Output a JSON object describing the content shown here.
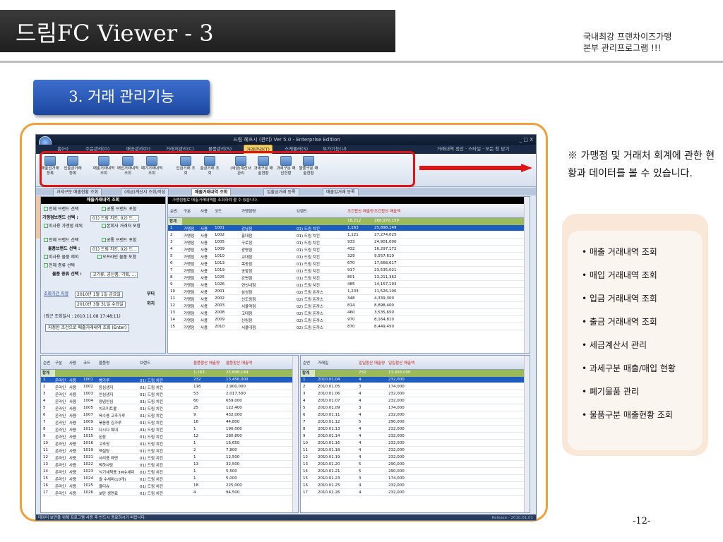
{
  "header": {
    "title": "드림FC Viewer - 3",
    "tagline_line1": "국내최강 프랜차이즈가맹",
    "tagline_line2": "본부 관리프로그램 !!!"
  },
  "section": {
    "label": "3. 거래 관리기능"
  },
  "app": {
    "title": "드림 헤프시 (관리) Ver 5.0 - Enterprise Edition",
    "window_controls": "_ □ X",
    "menu": [
      "홈(H)",
      "주문관리(O)",
      "배송관리(D)",
      "거래처관리(C)",
      "물품관리(S)",
      "거래관리(T)",
      "스케쥴러(S)",
      "부가기능(U)"
    ],
    "menu_active": "거래관리(T)",
    "menu_right": "거래내역 정산 · 스타일 · 모든 창 닫기",
    "ribbon": [
      "매출입거래 등록",
      "입출금거래 등록",
      "매출거래내역 조회",
      "매입거래내역 조회",
      "폐기거래내역 조회",
      "입금거래 조회",
      "출금거래 조회",
      "(세금)계산서 관리",
      "과세구분 매출현황",
      "과세구분 매입현황",
      "물품구분 매출현황"
    ],
    "tabs": [
      "과세구분 매출현황 조회",
      "(세금)계산서 조회/작성",
      "매출거래내역 조회",
      "입출금거래 등록",
      "매출입거래 등록"
    ],
    "active_tab": "매출거래내역 조회",
    "left_panel": {
      "title": "매출거래내역 조회",
      "all_brand": "전체 브랜드 선택",
      "common_brand": "공통 브랜드 포함",
      "franchise_brand_label": "가맹점브랜드 선택 :",
      "franchise_brand_value": "01) 드림 치킨, 02) 드...",
      "exclude_unused": "미사용 가맹점 제외",
      "include_head": "본회사 거래처 포함",
      "all_brand2": "전체 브랜드 선택",
      "common_brand2": "공통 브랜드 포함",
      "goods_brand_label": "물품브랜드 선택 :",
      "goods_brand_value": "01) 드림 치킨, 02) 드...",
      "exclude_unused_goods": "미사용 물품 제외",
      "include_ori": "오프라인 물품 포함",
      "all_kind": "전체 종류 선택",
      "kind_label": "물품 종류 선택 :",
      "kind_value": "고기류, 공산품, 기획, ...",
      "period_label": "조회기간 지정",
      "date_from": "2010년  1월  1일 금요일",
      "from_suffix": "부터",
      "date_to": "2010년  3월 31일 수요일",
      "to_suffix": "까지",
      "last_query": "(최근 조회일시 : 2010.11.08 17:48:11)",
      "button": "지정한 조건으로 매출거래내역 조회 (Enter)"
    },
    "top_grid": {
      "banner": "가맹점별로 매출거래내역을 조회하여 볼 수 있습니다.",
      "headers": [
        "순번",
        "구분",
        "사용",
        "코드",
        "가맹점명",
        "브랜드",
        "조건합산 매출량",
        "조건합산 매출액"
      ],
      "sum_label": "합계",
      "sum_qty": "18,212",
      "sum_amt": "268,970,159",
      "rows": [
        [
          "1",
          "가맹점",
          "사용",
          "1001",
          "강남점",
          "01) 드림 치킨",
          "1,163",
          "25,898,149"
        ],
        [
          "2",
          "가맹점",
          "사용",
          "1002",
          "홍대점",
          "01) 드림 치킨",
          "1,121",
          "27,274,025"
        ],
        [
          "3",
          "가맹점",
          "사용",
          "1005",
          "구로점",
          "01) 드림 치킨",
          "933",
          "24,901,000"
        ],
        [
          "4",
          "가맹점",
          "사용",
          "1009",
          "광명점",
          "01) 드림 치킨",
          "432",
          "16,297,172"
        ],
        [
          "5",
          "가맹점",
          "사용",
          "1010",
          "교대점",
          "01) 드림 치킨",
          "329",
          "9,557,610"
        ],
        [
          "6",
          "가맹점",
          "사용",
          "1013",
          "목동점",
          "01) 드림 치킨",
          "670",
          "17,668,617"
        ],
        [
          "7",
          "가맹점",
          "사용",
          "1019",
          "공항점",
          "01) 드림 치킨",
          "917",
          "23,535,021"
        ],
        [
          "8",
          "가맹점",
          "사용",
          "1025",
          "강변점",
          "01) 드림 치킨",
          "801",
          "13,211,362"
        ],
        [
          "9",
          "가맹점",
          "사용",
          "1026",
          "연신내점",
          "01) 드림 치킨",
          "485",
          "14,157,193"
        ],
        [
          "10",
          "가맹점",
          "사용",
          "2001",
          "삼성점",
          "02) 드림 돈까스",
          "1,233",
          "11,526,100"
        ],
        [
          "11",
          "가맹점",
          "사용",
          "2002",
          "신도림점",
          "02) 드림 돈까스",
          "348",
          "4,339,300"
        ],
        [
          "12",
          "가맹점",
          "사용",
          "2003",
          "서울역점",
          "02) 드림 돈까스",
          "814",
          "8,898,400"
        ],
        [
          "13",
          "가맹점",
          "사용",
          "2008",
          "고대점",
          "02) 드림 돈까스",
          "460",
          "3,535,650"
        ],
        [
          "14",
          "가맹점",
          "사용",
          "2009",
          "신림점",
          "02) 드림 돈까스",
          "970",
          "8,164,810"
        ],
        [
          "15",
          "가맹점",
          "사용",
          "2010",
          "서울대점",
          "02) 드림 돈까스",
          "870",
          "8,449,450"
        ]
      ]
    },
    "bottom_left_grid": {
      "headers": [
        "순번",
        "구분",
        "사용",
        "코드",
        "물품명",
        "브랜드",
        "물품합산 매출량",
        "물품합산 매출액"
      ],
      "sum_label": "합계",
      "sum_qty": "1,163",
      "sum_amt": "25,898,149",
      "rows": [
        [
          "1",
          "온라인",
          "사용",
          "1001",
          "빵가루",
          "01) 드림 치킨",
          "232",
          "13,456,000"
        ],
        [
          "2",
          "온라인",
          "사용",
          "1002",
          "등심생지",
          "01) 드림 치킨",
          "116",
          "2,900,000"
        ],
        [
          "3",
          "온라인",
          "사용",
          "1003",
          "안심생지",
          "01) 드림 치킨",
          "53",
          "2,017,500"
        ],
        [
          "4",
          "온라인",
          "사용",
          "1004",
          "양념안심",
          "01) 드림 치킨",
          "60",
          "659,000"
        ],
        [
          "5",
          "온라인",
          "사용",
          "1005",
          "치즈미트볼",
          "01) 드림 치킨",
          "25",
          "122,400"
        ],
        [
          "6",
          "온라인",
          "사용",
          "1007",
          "육수용 고추가루",
          "01) 드림 치킨",
          "9",
          "432,000"
        ],
        [
          "7",
          "온라인",
          "사용",
          "1009",
          "볶음용 김가루",
          "01) 드림 치킨",
          "16",
          "44,800"
        ],
        [
          "8",
          "온라인",
          "사용",
          "1011",
          "다시다 특대",
          "01) 드림 치킨",
          "1",
          "190,000"
        ],
        [
          "9",
          "온라인",
          "사용",
          "1015",
          "된장",
          "01) 드림 치킨",
          "12",
          "280,800"
        ],
        [
          "10",
          "온라인",
          "사용",
          "1016",
          "고추장",
          "01) 드림 치킨",
          "1",
          "16,650"
        ],
        [
          "11",
          "온라인",
          "사용",
          "1019",
          "백설탕",
          "01) 드림 치킨",
          "2",
          "7,800"
        ],
        [
          "12",
          "온라인",
          "사용",
          "1021",
          "사리용 라면",
          "01) 드림 치킨",
          "1",
          "12,500"
        ],
        [
          "13",
          "온라인",
          "사용",
          "1022",
          "박하사탕",
          "01) 드림 치킨",
          "13",
          "32,500"
        ],
        [
          "14",
          "온라인",
          "사용",
          "1023",
          "식기세척용 3M수세미",
          "01) 드림 치킨",
          "1",
          "5,500"
        ],
        [
          "15",
          "온라인",
          "사용",
          "1024",
          "쌀 수세미(10개)",
          "01) 드림 치킨",
          "1",
          "5,000"
        ],
        [
          "16",
          "온라인",
          "사용",
          "1025",
          "물티슈",
          "01) 드림 치킨",
          "18",
          "225,000"
        ],
        [
          "17",
          "온라인",
          "사용",
          "1026",
          "보탄 생연료",
          "01) 드림 치킨",
          "4",
          "94,500"
        ]
      ]
    },
    "bottom_right_grid": {
      "headers": [
        "순번",
        "거래일",
        "일일합산 매출량",
        "일일합산 매출액"
      ],
      "sum_label": "합계",
      "sum_qty": "232",
      "sum_amt": "13,456,000",
      "rows": [
        [
          "1",
          "2010.01.04",
          "4",
          "232,000"
        ],
        [
          "2",
          "2010.01.05",
          "3",
          "174,000"
        ],
        [
          "3",
          "2010.01.06",
          "4",
          "232,000"
        ],
        [
          "4",
          "2010.01.07",
          "4",
          "232,000"
        ],
        [
          "5",
          "2010.01.09",
          "3",
          "174,000"
        ],
        [
          "6",
          "2010.01.11",
          "4",
          "232,000"
        ],
        [
          "7",
          "2010.01.12",
          "5",
          "290,000"
        ],
        [
          "8",
          "2010.01.13",
          "4",
          "232,000"
        ],
        [
          "9",
          "2010.01.14",
          "4",
          "232,000"
        ],
        [
          "10",
          "2010.01.16",
          "4",
          "232,000"
        ],
        [
          "11",
          "2010.01.18",
          "4",
          "232,000"
        ],
        [
          "12",
          "2010.01.19",
          "4",
          "232,000"
        ],
        [
          "13",
          "2010.01.20",
          "5",
          "290,000"
        ],
        [
          "14",
          "2010.01.21",
          "5",
          "290,000"
        ],
        [
          "15",
          "2010.01.23",
          "3",
          "174,000"
        ],
        [
          "16",
          "2010.01.25",
          "4",
          "232,000"
        ],
        [
          "17",
          "2010.01.26",
          "4",
          "232,000"
        ]
      ]
    },
    "status": "데이터 보안을 위해 프로그램 사용 후 반드시 종료하시기 바랍니다.",
    "status_right": "Release - 2010.01.01"
  },
  "note": "※ 가맹점 및 거래처 회계에 관한 현황과 데이터를 볼 수 있습니다.",
  "features": [
    "• 매출 거래내역 조회",
    "• 매입 거래내역 조회",
    "• 입금 거래내역 조회",
    "• 출금 거래내역 조회",
    "• 세금계산서 관리",
    "• 과세구분 매출/매입 현황",
    "• 폐기물품 관리",
    "• 물품구분 매출현황 조회"
  ],
  "page_number": "-12-",
  "colors": {
    "accent_orange": "#f0a036",
    "highlight_red": "#e01414",
    "section_blue": "#1c47a0",
    "selected_row": "#1f5cc0",
    "sum_green": "#9bbb5a"
  }
}
